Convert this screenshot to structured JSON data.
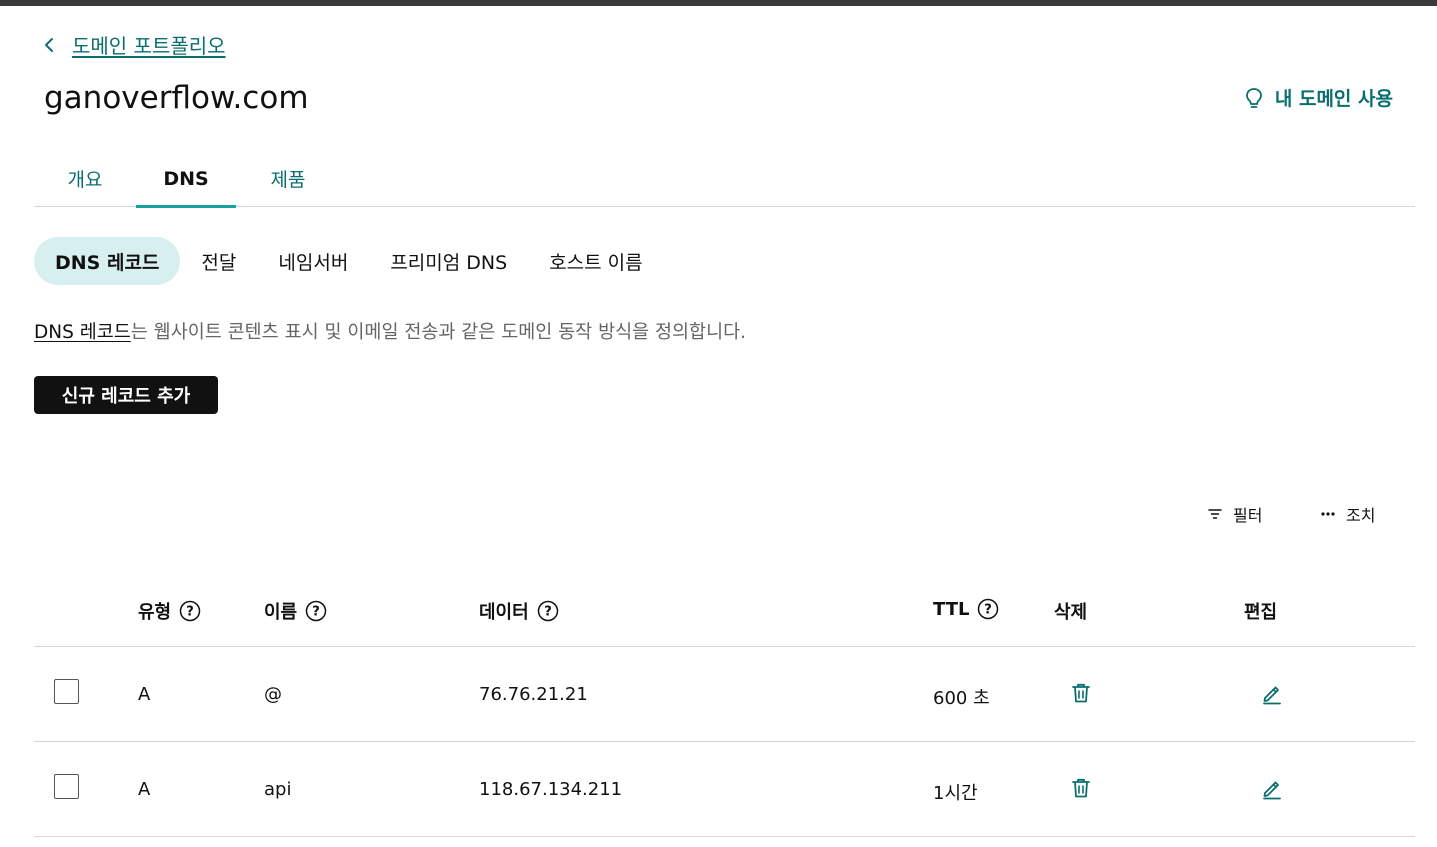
{
  "nav": {
    "back_label": "도메인 포트폴리오"
  },
  "domain": {
    "name": "ganoverflow.com",
    "use_label": "내 도메인 사용"
  },
  "tabs": [
    {
      "label": "개요"
    },
    {
      "label": "DNS"
    },
    {
      "label": "제품"
    }
  ],
  "subtabs": [
    {
      "label": "DNS 레코드"
    },
    {
      "label": "전달"
    },
    {
      "label": "네임서버"
    },
    {
      "label": "프리미엄 DNS"
    },
    {
      "label": "호스트 이름"
    }
  ],
  "description": {
    "link": "DNS 레코드",
    "text": "는 웹사이트 콘텐츠 표시 및 이메일 전송과 같은 도메인 동작 방식을 정의합니다."
  },
  "add_button": "신규 레코드 추가",
  "tools": {
    "filter": "필터",
    "actions": "조치"
  },
  "table": {
    "headers": {
      "type": "유형",
      "name": "이름",
      "data": "데이터",
      "ttl": "TTL",
      "delete": "삭제",
      "edit": "편집"
    },
    "rows": [
      {
        "type": "A",
        "name": "@",
        "data": "76.76.21.21",
        "ttl": "600 초"
      },
      {
        "type": "A",
        "name": "api",
        "data": "118.67.134.211",
        "ttl": "1시간"
      }
    ]
  },
  "colors": {
    "accent": "#0a6e6e",
    "tab_underline": "#17a2a2",
    "active_pill": "#d8efef",
    "button_bg": "#111111"
  }
}
